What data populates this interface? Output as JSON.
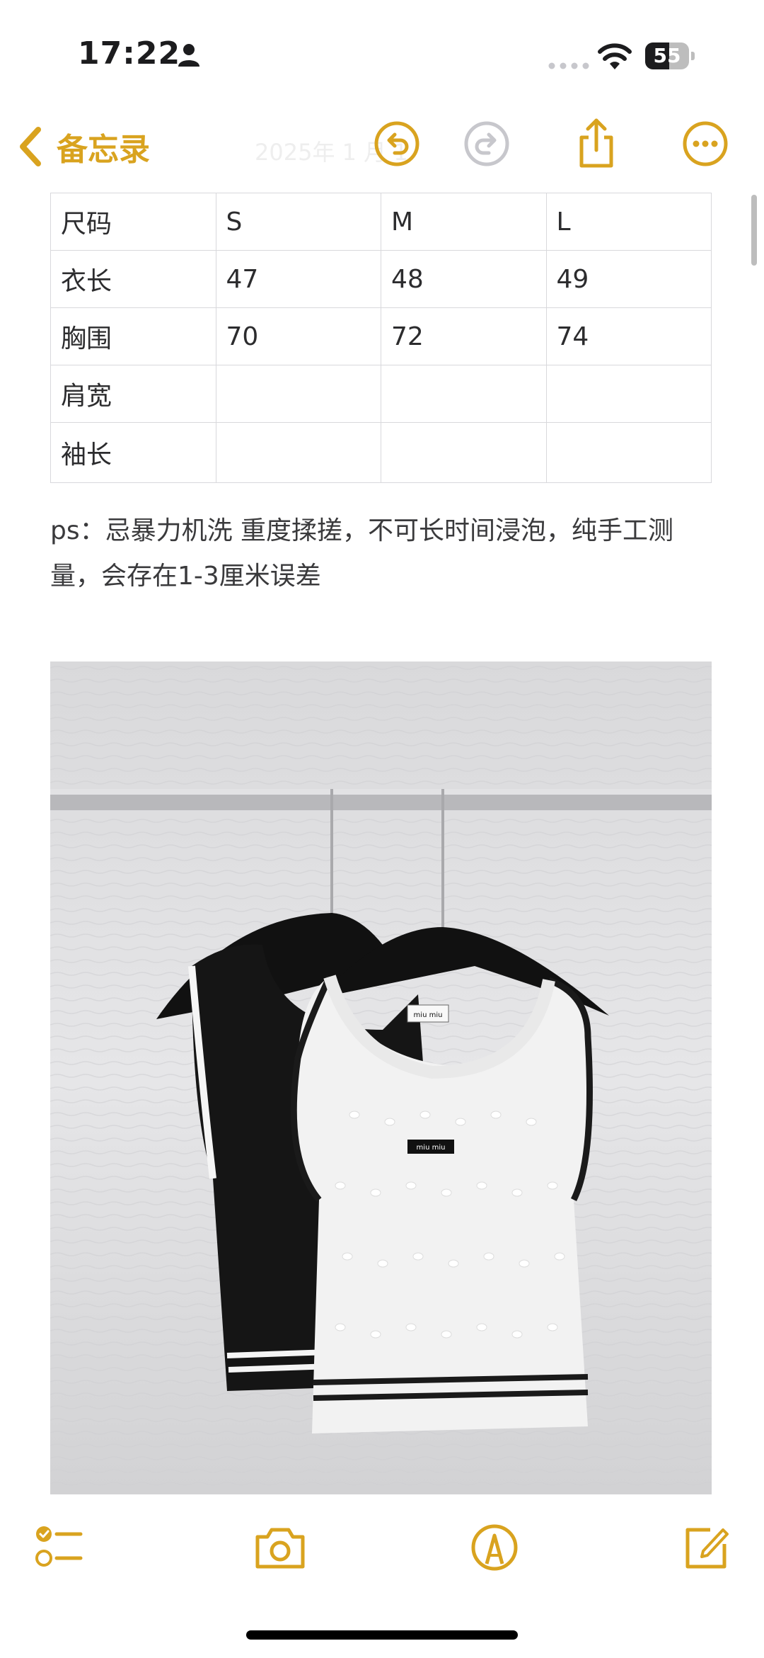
{
  "status_bar": {
    "time": "17:22",
    "battery_level": "55",
    "battery_fraction": 0.55,
    "icons": [
      "person-icon",
      "signal-dots-icon",
      "wifi-icon",
      "battery-icon"
    ]
  },
  "nav": {
    "back_label": "备忘录",
    "date_text": "2025年 1 月 1",
    "icons": [
      "back-chevron-icon",
      "undo-icon",
      "redo-icon",
      "share-icon",
      "more-icon"
    ]
  },
  "colors": {
    "accent": "#d9a31f",
    "text": "#2c2c2e",
    "grid": "#d8d8dc"
  },
  "size_table": {
    "rows": [
      [
        "尺码",
        "S",
        "M",
        "L"
      ],
      [
        "衣长",
        "47",
        "48",
        "49"
      ],
      [
        "胸围",
        "70",
        "72",
        "74"
      ],
      [
        "肩宽",
        "",
        "",
        ""
      ],
      [
        "袖长",
        "",
        "",
        ""
      ]
    ]
  },
  "note": {
    "text": "ps：忌暴力机洗 重度揉搓，不可长时间浸泡，纯手工测量，会存在1-3厘米误差"
  },
  "photo": {
    "label_left": "miu miu",
    "label_right": "miu miu"
  },
  "toolbar": {
    "icons": [
      "checklist-icon",
      "camera-icon",
      "markup-pen-icon",
      "compose-icon"
    ]
  }
}
